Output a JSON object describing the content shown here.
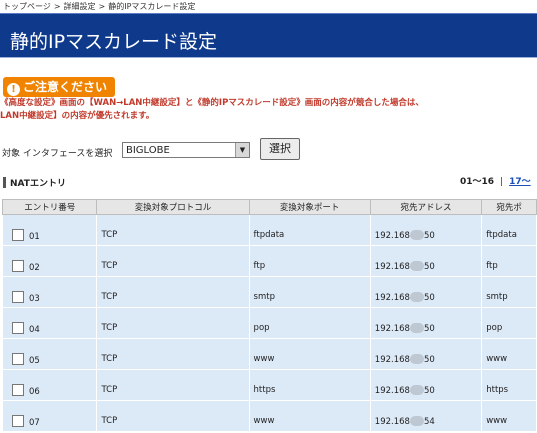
{
  "breadcrumb": {
    "items": [
      "トップページ",
      "詳細設定",
      "静的IPマスカレード設定"
    ],
    "separator": ">"
  },
  "page_title": "静的IPマスカレード設定",
  "caution": {
    "label": "ご注意ください",
    "icon": "exclamation-icon",
    "line1": "《高度な設定》画面の【WAN→LAN中継設定】と《静的IPマスカレード設定》画面の内容が競合した場合は、",
    "line2": "LAN中継設定】の内容が優先されます。"
  },
  "interface_select": {
    "label": "対象 インタフェースを選択",
    "selected": "BIGLOBE",
    "button": "選択"
  },
  "section_title": "NATエントリ",
  "pager": {
    "current": "01～16",
    "next": "17～"
  },
  "table": {
    "headers": [
      "エントリ番号",
      "変換対象プロトコル",
      "変換対象ポート",
      "宛先アドレス",
      "宛先ポ"
    ],
    "rows": [
      {
        "num": "01",
        "protocol": "TCP",
        "port": "ftpdata",
        "addr_a": "192.168",
        "addr_b": "50",
        "dest_port": "ftpdata"
      },
      {
        "num": "02",
        "protocol": "TCP",
        "port": "ftp",
        "addr_a": "192.168",
        "addr_b": "50",
        "dest_port": "ftp"
      },
      {
        "num": "03",
        "protocol": "TCP",
        "port": "smtp",
        "addr_a": "192.168",
        "addr_b": "50",
        "dest_port": "smtp"
      },
      {
        "num": "04",
        "protocol": "TCP",
        "port": "pop",
        "addr_a": "192.168",
        "addr_b": "50",
        "dest_port": "pop"
      },
      {
        "num": "05",
        "protocol": "TCP",
        "port": "www",
        "addr_a": "192.168",
        "addr_b": "50",
        "dest_port": "www"
      },
      {
        "num": "06",
        "protocol": "TCP",
        "port": "https",
        "addr_a": "192.168",
        "addr_b": "50",
        "dest_port": "https"
      },
      {
        "num": "07",
        "protocol": "TCP",
        "port": "www",
        "addr_a": "192.168",
        "addr_b": "54",
        "dest_port": "www"
      }
    ]
  },
  "colors": {
    "title_bg": "#0f3a8c",
    "caution_bg": "#f08300",
    "notice_text": "#c0392b",
    "row_bg": "#dce9f7"
  }
}
